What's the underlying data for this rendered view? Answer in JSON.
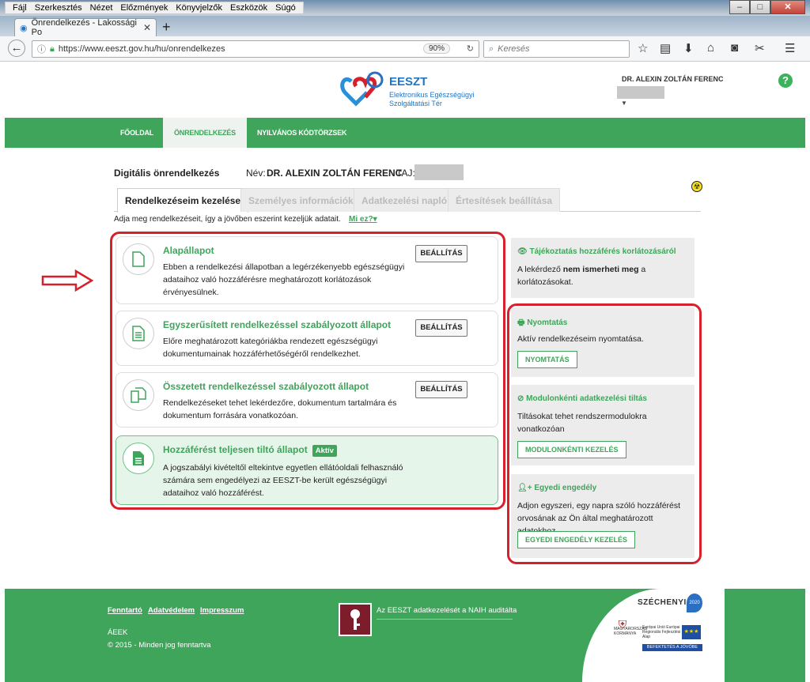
{
  "browser": {
    "menu": [
      "Fájl",
      "Szerkesztés",
      "Nézet",
      "Előzmények",
      "Könyvjelzők",
      "Eszközök",
      "Súgó"
    ],
    "tab_title": "Önrendelkezés - Lakossági Po",
    "url": "https://www.eeszt.gov.hu/hu/onrendelkezes",
    "zoom": "90%",
    "search_placeholder": "Keresés"
  },
  "header": {
    "logo_title": "EESZT",
    "logo_sub1": "Elektronikus Egészségügyi",
    "logo_sub2": "Szolgáltatási Tér",
    "user_name": "DR. ALEXIN ZOLTÁN FERENC"
  },
  "nav": [
    "FŐOLDAL",
    "ÖNRENDELKEZÉS",
    "NYILVÁNOS KÓDTÖRZSEK"
  ],
  "main": {
    "title": "Digitális önrendelkezés",
    "nev_label": "Név:",
    "nev_value": "DR. ALEXIN ZOLTÁN FERENC",
    "taj_label": "TAJ:",
    "tabs": [
      "Rendelkezéseim kezelése",
      "Személyes információk",
      "Adatkezelési napló",
      "Értesítések beállítása"
    ],
    "intro": "Adja meg rendelkezéseit, így a jövőben eszerint kezeljük adatait.",
    "miez": "Mi ez?"
  },
  "cards": [
    {
      "title": "Alapállapot",
      "desc": "Ebben a rendelkezési állapotban a legérzékenyebb egészségügyi adataihoz való hozzáférésre meghatározott korlátozások érvényesülnek.",
      "button": "BEÁLLÍTÁS"
    },
    {
      "title": "Egyszerűsített rendelkezéssel szabályozott állapot",
      "desc": "Előre meghatározott kategóriákba rendezett egészségügyi dokumentumainak hozzáférhetőségéről rendelkezhet.",
      "button": "BEÁLLÍTÁS"
    },
    {
      "title": "Összetett rendelkezéssel szabályozott állapot",
      "desc": "Rendelkezéseket tehet lekérdezőre, dokumentum tartalmára és dokumentum forrására vonatkozóan.",
      "button": "BEÁLLÍTÁS"
    },
    {
      "title": "Hozzáférést teljesen tiltó állapot",
      "badge": "Aktív",
      "desc": "A jogszabályi kivételtől eltekintve egyetlen ellátóoldali felhasználó számára sem engedélyezi az EESZT-be került egészségügyi adataihoz való hozzáférést."
    }
  ],
  "right": {
    "info_title": "Tájékoztatás hozzáférés korlátozásáról",
    "info_text_1": "A lekérdező ",
    "info_text_bold": "nem ismerheti meg",
    "info_text_2": " a korlátozásokat.",
    "print_title": "Nyomtatás",
    "print_text": "Aktív rendelkezéseim nyomtatása.",
    "print_button": "NYOMTATÁS",
    "module_title": "Modulonkénti adatkezelési tiltás",
    "module_text": "Tiltásokat tehet rendszermodulokra vonatkozóan",
    "module_button": "MODULONKÉNTI KEZELÉS",
    "single_title": "Egyedi engedély",
    "single_text": "Adjon egyszeri, egy napra szóló hozzáférést orvosának az Ön által meghatározott adatokhoz.",
    "single_button": "EGYEDI ENGEDÉLY KEZELÉS"
  },
  "footer": {
    "links": [
      "Fenntartó",
      "Adatvédelem",
      "Impresszum"
    ],
    "naih": "Az EESZT adatkezelését a NAIH auditálta",
    "aeek": "ÁEEK",
    "copyright": "© 2015 - Minden jog fenntartva",
    "szechenyi": "SZÉCHENYI",
    "s2020": "2020",
    "eu_text": "Európai Unió Európai Regionális Fejlesztési Alap",
    "befektetes": "BEFEKTETÉS A JÖVŐBE",
    "kormany": "MAGYARORSZÁG KORMÁNYA"
  },
  "colors": {
    "accent": "#3ea55a",
    "highlight": "#d6202b",
    "brand_blue": "#2176c3"
  }
}
